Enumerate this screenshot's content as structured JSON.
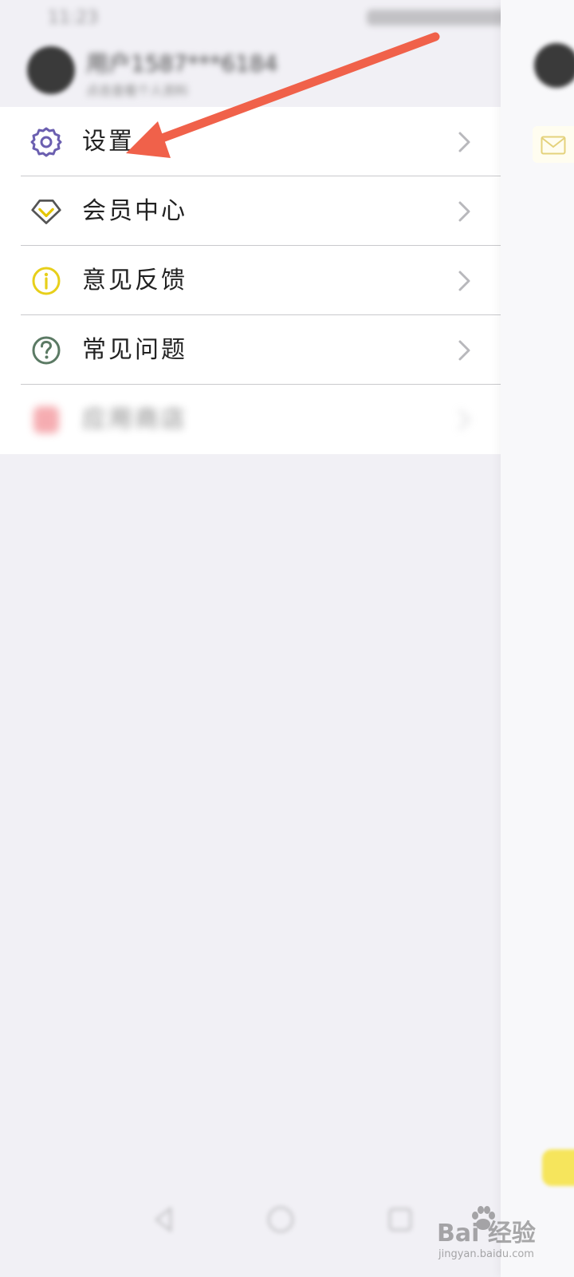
{
  "status_bar": {
    "time": "11:23"
  },
  "profile": {
    "name": "用户1587***6184",
    "subtitle": "点击查看个人资料"
  },
  "menu": {
    "items": [
      {
        "label": "设置",
        "icon": "gear-icon"
      },
      {
        "label": "会员中心",
        "icon": "diamond-icon"
      },
      {
        "label": "意见反馈",
        "icon": "info-icon"
      },
      {
        "label": "常见问题",
        "icon": "question-icon"
      },
      {
        "label": "应用商店",
        "icon": "red-app-icon"
      }
    ]
  },
  "watermark": {
    "text": "Bai 经验",
    "url": "jingyan.baidu.com"
  },
  "colors": {
    "arrow": "#f0614a",
    "gear": "#6b5fb0",
    "diamond_outline": "#555555",
    "diamond_check": "#e5c600",
    "info": "#e7cf1a",
    "question": "#5b7a64",
    "red_app": "#ee6a72",
    "mail": "#e4d27c"
  }
}
